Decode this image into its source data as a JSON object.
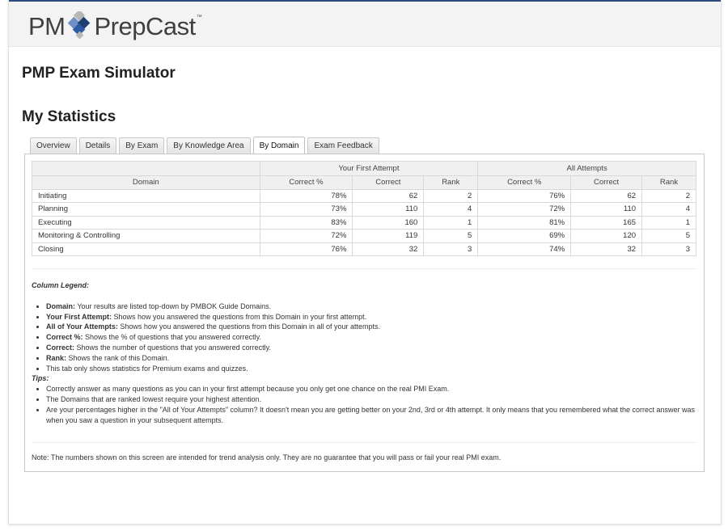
{
  "brand": {
    "name_left": "PM",
    "name_right": "PrepCast",
    "trademark": "™",
    "colors": {
      "dark_blue": "#1f3f73",
      "light_blue": "#6f8fc6",
      "gray": "#b7b7b7",
      "text": "#3f3f3f"
    }
  },
  "page_title": "PMP Exam Simulator",
  "section_title": "My Statistics",
  "tabs": [
    {
      "label": "Overview",
      "active": false
    },
    {
      "label": "Details",
      "active": false
    },
    {
      "label": "By Exam",
      "active": false
    },
    {
      "label": "By Knowledge Area",
      "active": false
    },
    {
      "label": "By Domain",
      "active": true
    },
    {
      "label": "Exam Feedback",
      "active": false
    }
  ],
  "table": {
    "group_headers": [
      "Your First Attempt",
      "All Attempts"
    ],
    "columns": [
      "Domain",
      "Correct %",
      "Correct",
      "Rank",
      "Correct %",
      "Correct",
      "Rank"
    ],
    "rows": [
      [
        "Initiating",
        "78%",
        "62",
        "2",
        "76%",
        "62",
        "2"
      ],
      [
        "Planning",
        "73%",
        "110",
        "4",
        "72%",
        "110",
        "4"
      ],
      [
        "Executing",
        "83%",
        "160",
        "1",
        "81%",
        "165",
        "1"
      ],
      [
        "Monitoring & Controlling",
        "72%",
        "119",
        "5",
        "69%",
        "120",
        "5"
      ],
      [
        "Closing",
        "76%",
        "32",
        "3",
        "74%",
        "32",
        "3"
      ]
    ]
  },
  "legend": {
    "heading": "Column Legend:",
    "items": [
      {
        "term": "Domain:",
        "text": " Your results are listed top-down by PMBOK Guide Domains."
      },
      {
        "term": "Your First Attempt:",
        "text": " Shows how you answered the questions from this Domain in your first attempt."
      },
      {
        "term": "All of Your Attempts:",
        "text": " Shows how you answered the questions from this Domain in all of your attempts."
      },
      {
        "term": "Correct %:",
        "text": " Shows the % of questions that you answered correctly."
      },
      {
        "term": "Correct:",
        "text": " Shows the number of questions that you answered correctly."
      },
      {
        "term": "Rank:",
        "text": " Shows the rank of this Domain."
      },
      {
        "term": "",
        "text": "This tab only shows statistics for Premium exams and quizzes."
      }
    ]
  },
  "tips": {
    "heading": "Tips:",
    "items": [
      "Correctly answer as many questions as you can in your first attempt because you only get one chance on the real PMI Exam.",
      "The Domains that are ranked lowest require your highest attention.",
      "Are your percentages higher in the \"All of Your Attempts\" column? It doesn't mean you are getting better on your 2nd, 3rd or 4th attempt. It only means that you remembered what the correct answer was when you saw a question in your subsequent attempts."
    ]
  },
  "note": "Note: The numbers shown on this screen are intended for trend analysis only. They are no guarantee that you will pass or fail your real PMI exam."
}
